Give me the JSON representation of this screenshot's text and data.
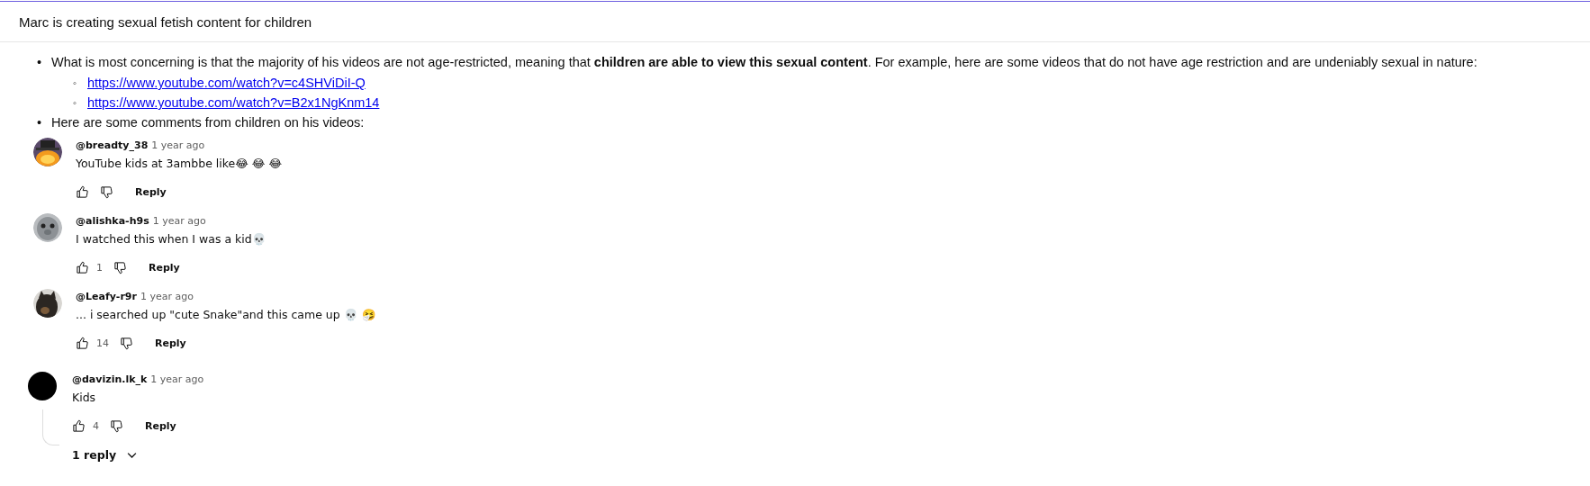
{
  "header": {
    "title": "Marc is creating sexual fetish content for children"
  },
  "bullets": [
    {
      "marker": "•",
      "text": "What is most concerning is that the majority of his videos are not age-restricted, meaning that **children are able to view this sexual content**. For example, here are some videos that do not have age restriction and are undeniably sexual in nature:",
      "links": [
        {
          "marker": "◦",
          "url": "https://www.youtube.com/watch?v=c4SHViDiI-Q"
        },
        {
          "marker": "◦",
          "url": "https://www.youtube.com/watch?v=B2x1NgKnm14"
        }
      ]
    },
    {
      "marker": "•",
      "text": "Here are some comments from children on his videos:"
    }
  ],
  "comments": [
    {
      "avatar": {
        "kind": "pumpkin"
      },
      "author": "@breadty_38",
      "time": "1 year ago",
      "text": "YouTube kids at 3ambbe like😂 😂 😂",
      "reply": "Reply"
    },
    {
      "avatar": {
        "kind": "seal"
      },
      "author": "@alishka-h9s",
      "time": "1 year ago",
      "text": "I watched this when I was a kid💀",
      "likes": "1",
      "reply": "Reply"
    },
    {
      "avatar": {
        "kind": "cat"
      },
      "author": "@Leafy-r9r",
      "time": "1 year ago",
      "text": "... i searched up \"cute Snake\"and this came up  💀 🤧",
      "likes": "14",
      "reply": "Reply"
    },
    {
      "avatar": {
        "kind": "plain"
      },
      "author": "@davizin.lk_k",
      "time": "1 year ago",
      "text": "Kids",
      "likes": "4",
      "reply": "Reply",
      "replies": "1 reply"
    }
  ]
}
